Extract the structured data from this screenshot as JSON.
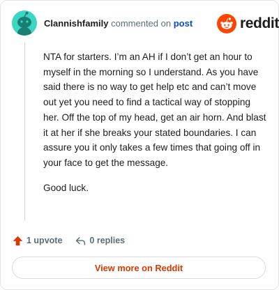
{
  "header": {
    "username": "Clannishfamily",
    "commented_text": "commented on",
    "post_link": "post",
    "avatar_icon": "snoo-avatar-icon",
    "avatar_color": "#3dd6c2"
  },
  "brand": {
    "name": "reddit",
    "icon": "reddit-logo-icon",
    "color": "#ff4500"
  },
  "comment": {
    "paragraphs": [
      "NTA for starters. I’m an AH if I don’t get an hour to myself in the morning so I understand. As you have said there is no way to get help etc and can’t move out yet you need to find a tactical way of stopping her. Off the top of my head, get an air horn. And blast it at her if she breaks your stated boundaries. I can assure you it only takes a few times that going off in your face to get the message.",
      "Good luck."
    ]
  },
  "actions": {
    "upvote_label": "1 upvote",
    "upvote_icon": "upvote-arrow-icon",
    "upvote_color": "#d93900",
    "reply_label": "0 replies",
    "reply_icon": "reply-arrow-icon"
  },
  "footer": {
    "view_more_label": "View more on Reddit",
    "accent": "#d93900"
  }
}
